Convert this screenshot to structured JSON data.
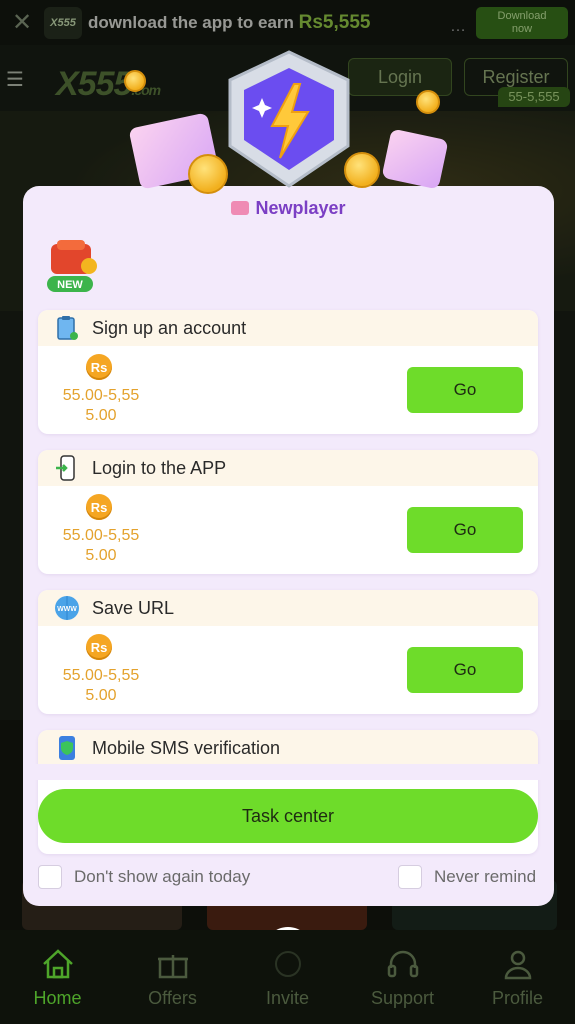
{
  "topbanner": {
    "logo": "X555",
    "text": "download the app to earn",
    "amount": "Rs5,555",
    "download_label_1": "Download",
    "download_label_2": "now"
  },
  "header": {
    "logo": "X555",
    "logo_suffix": ".com",
    "login_label": "Login",
    "register_label": "Register",
    "register_badge": "55-5,555"
  },
  "modal": {
    "title": "Newplayer",
    "new_badge": "NEW",
    "tasks": [
      {
        "label": "Sign up an account",
        "currency": "Rs",
        "reward_line1": "55.00-5,55",
        "reward_line2": "5.00",
        "button": "Go",
        "icon": "clipboard-check-icon"
      },
      {
        "label": "Login to the APP",
        "currency": "Rs",
        "reward_line1": "55.00-5,55",
        "reward_line2": "5.00",
        "button": "Go",
        "icon": "phone-login-icon"
      },
      {
        "label": "Save URL",
        "currency": "Rs",
        "reward_line1": "55.00-5,55",
        "reward_line2": "5.00",
        "button": "Go",
        "icon": "www-globe-icon"
      },
      {
        "label": "Mobile SMS verification",
        "icon": "phone-shield-icon"
      }
    ],
    "task_center_label": "Task center",
    "dont_show_label": "Don't show again today",
    "never_remind_label": "Never remind"
  },
  "nav": {
    "items": [
      {
        "label": "Home",
        "icon": "home-icon",
        "active": true
      },
      {
        "label": "Offers",
        "icon": "gift-icon",
        "active": false
      },
      {
        "label": "Invite",
        "icon": "invite-icon",
        "active": false
      },
      {
        "label": "Support",
        "icon": "headset-icon",
        "active": false
      },
      {
        "label": "Profile",
        "icon": "profile-icon",
        "active": false
      }
    ]
  },
  "colors": {
    "accent_green": "#6edc2a",
    "title_purple": "#7b3fc4",
    "reward_gold": "#e4a22d",
    "modal_bg": "#f3eafb"
  }
}
